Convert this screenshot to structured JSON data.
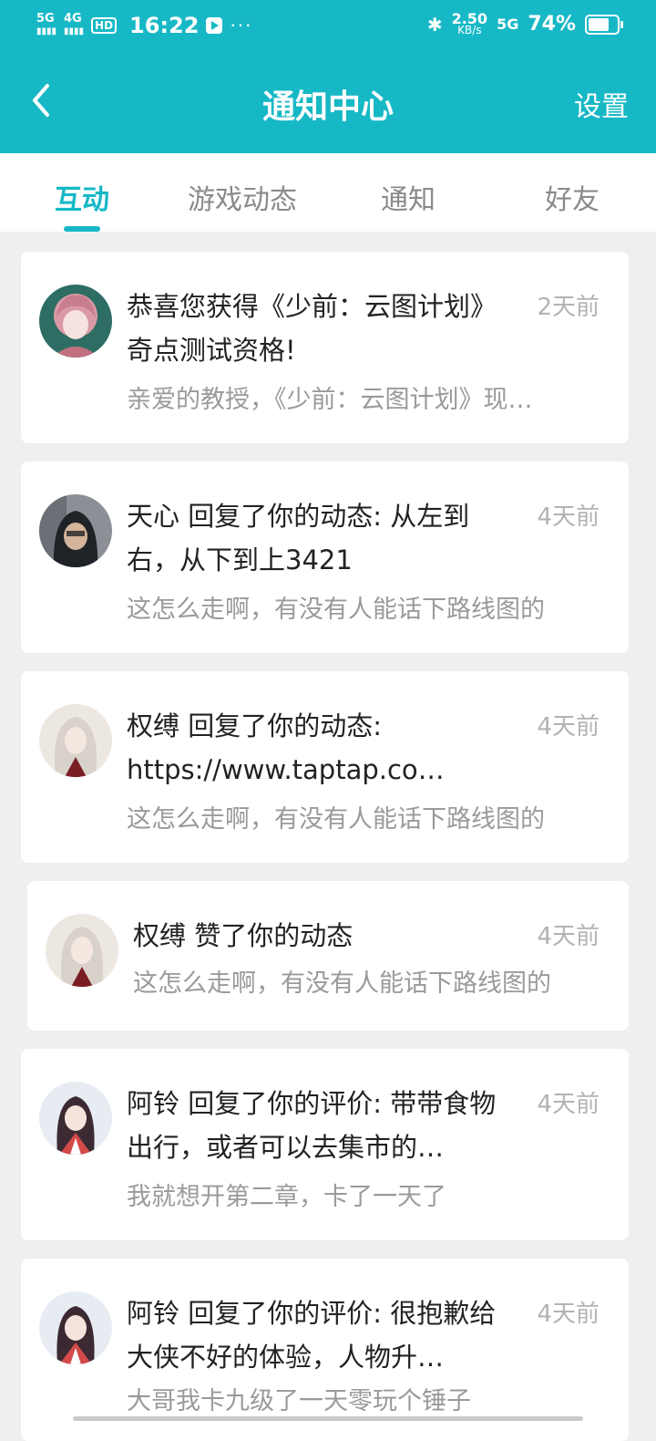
{
  "status_bar": {
    "time": "16:22",
    "net_speed": "2.50",
    "net_unit": "KB/s",
    "battery": "74%",
    "battery_level": 0.74,
    "signal1": "5G",
    "signal2": "4G",
    "hd": "HD",
    "net_type": "5G"
  },
  "header": {
    "title": "通知中心",
    "settings_label": "设置"
  },
  "tabs": [
    {
      "label": "互动",
      "active": true
    },
    {
      "label": "游戏动态"
    },
    {
      "label": "通知"
    },
    {
      "label": "好友"
    }
  ],
  "notifications": [
    {
      "title": "恭喜您获得《少前：云图计划》奇点测试资格!",
      "preview": "亲爱的教授，《少前：云图计划》现…",
      "time": "2天前",
      "avatar": "anime-girl-pink-avatar"
    },
    {
      "title": "天心 回复了你的动态: 从左到右，从下到上3421",
      "preview": "这怎么走啊，有没有人能话下路线图的",
      "time": "4天前",
      "avatar": "hooded-person-avatar"
    },
    {
      "title": "权缚 回复了你的动态: https://www.taptap.co…",
      "preview": "这怎么走啊，有没有人能话下路线图的",
      "time": "4天前",
      "avatar": "white-hair-avatar"
    },
    {
      "title": "权缚 赞了你的动态",
      "preview": "这怎么走啊，有没有人能话下路线图的",
      "time": "4天前",
      "avatar": "white-hair-avatar"
    },
    {
      "title": "阿铃 回复了你的评价: 带带食物出行，或者可以去集市的…",
      "preview": "我就想开第二章，卡了一天了",
      "time": "4天前",
      "avatar": "kimono-girl-avatar"
    },
    {
      "title": "阿铃 回复了你的评价: 很抱歉给大侠不好的体验，人物升…",
      "preview": "大哥我卡九级了一天零玩个锤子",
      "time": "4天前",
      "avatar": "kimono-girl-avatar"
    }
  ]
}
